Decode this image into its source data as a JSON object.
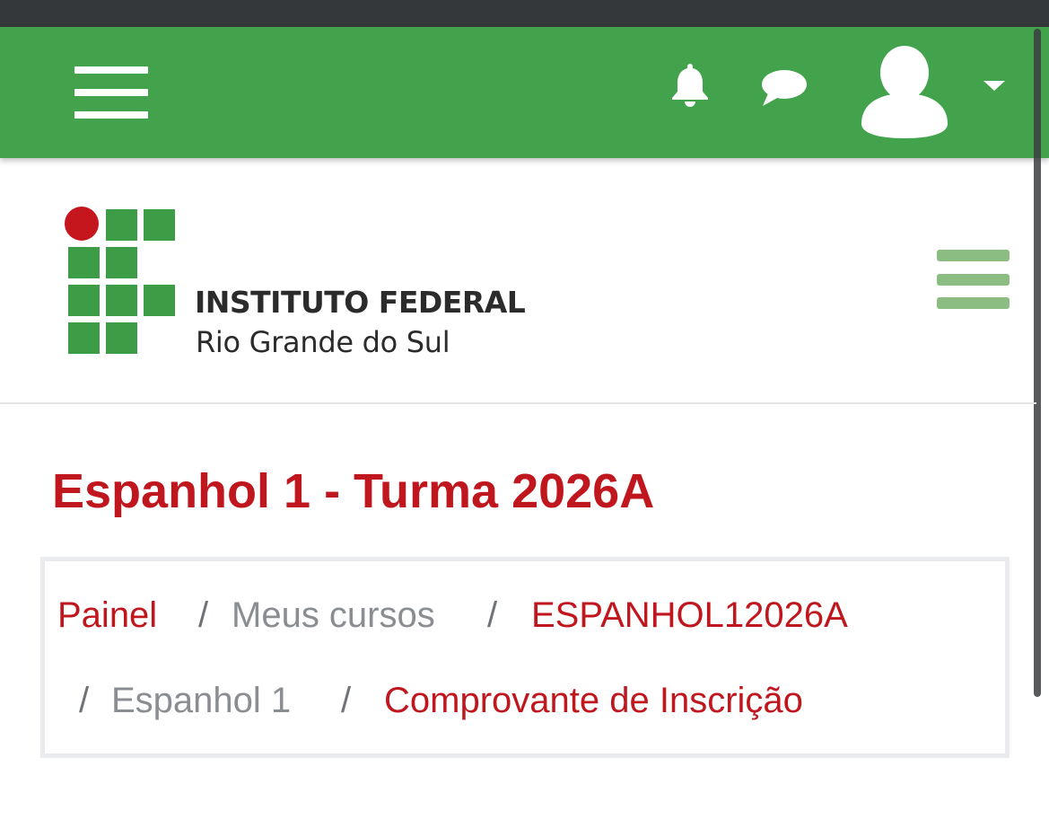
{
  "header": {
    "menu_icon": "hamburger-icon",
    "notifications_icon": "bell-icon",
    "messages_icon": "chat-bubble-icon",
    "user_icon": "user-avatar-icon",
    "dropdown_icon": "caret-down-icon",
    "bar_color": "#43a34c"
  },
  "logo": {
    "line1": "INSTITUTO FEDERAL",
    "line2": "Rio Grande do Sul",
    "red_color": "#c4161c",
    "green_color": "#3d9c46"
  },
  "nav_menu_icon": "hamburger-icon",
  "course": {
    "title": "Espanhol 1 - Turma 2026A"
  },
  "breadcrumb": {
    "separator": "/",
    "items": [
      {
        "label": "Painel",
        "link": true
      },
      {
        "label": "Meus cursos",
        "link": false
      },
      {
        "label": "ESPANHOL12026A",
        "link": true
      },
      {
        "label": "Espanhol 1",
        "link": false
      },
      {
        "label": "Comprovante de Inscrição",
        "link": true
      }
    ]
  },
  "colors": {
    "accent_red": "#c0171f",
    "muted_gray": "#8a8d91"
  }
}
